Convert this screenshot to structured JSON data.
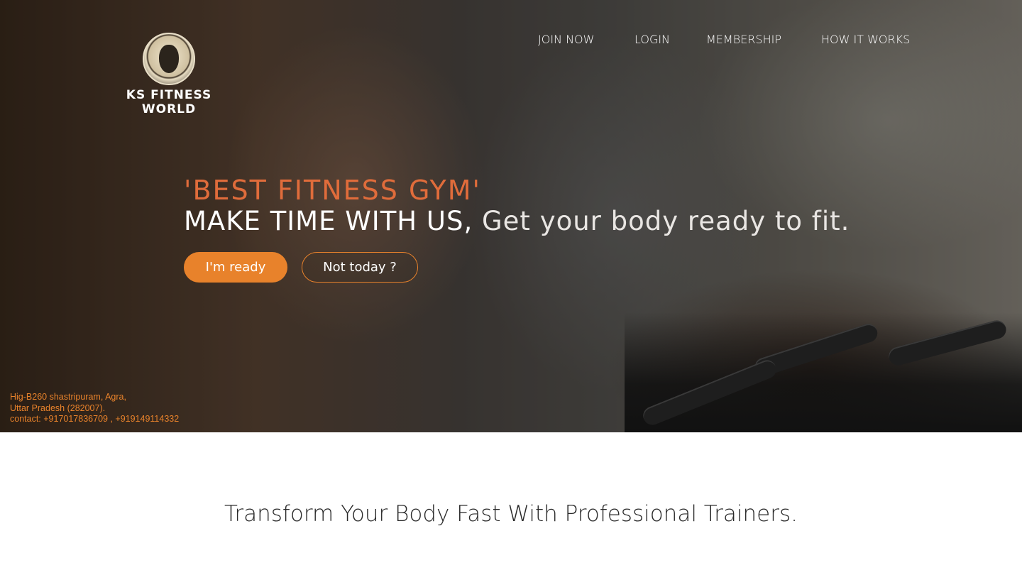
{
  "brand": {
    "name": "KS FITNESS WORLD",
    "logo_icon": "king-medallion-icon"
  },
  "nav": {
    "items": [
      {
        "label": "JOIN NOW"
      },
      {
        "label": "LOGIN"
      },
      {
        "label": "MEMBERSHIP"
      },
      {
        "label": "HOW IT WORKS"
      }
    ]
  },
  "hero": {
    "headline_accent": "'BEST FITNESS GYM'",
    "headline_main": "MAKE TIME WITH US,",
    "headline_sub": " Get your body ready to fit.",
    "primary_button": "I'm ready",
    "secondary_button": "Not today ?"
  },
  "address": {
    "line1": "Hig-B260 shastripuram, Agra,",
    "line2": "Uttar Pradesh (282007).",
    "line3": "contact: +917017836709 , +919149114332"
  },
  "section": {
    "tagline": "Transform Your Body Fast With Professional Trainers."
  },
  "colors": {
    "accent": "#e8822b",
    "headline_accent": "#e06c3b",
    "text_dark": "#2a2a2a"
  }
}
